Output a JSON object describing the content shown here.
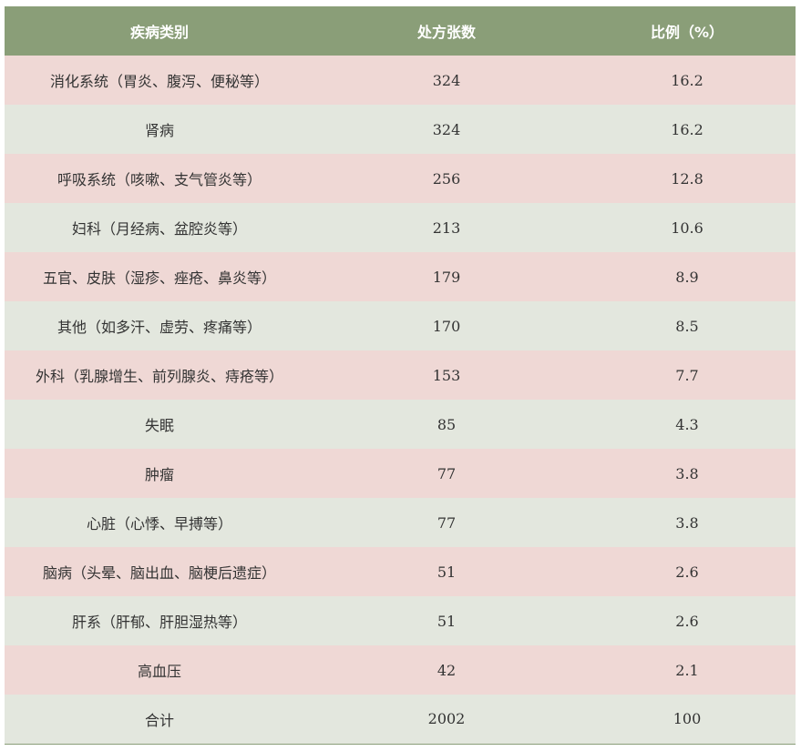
{
  "table": {
    "headers": [
      "疾病类别",
      "处方张数",
      "比例（%）"
    ],
    "rows": [
      [
        "消化系统（胃炎、腹泻、便秘等）",
        "324",
        "16.2"
      ],
      [
        "肾病",
        "324",
        "16.2"
      ],
      [
        "呼吸系统（咳嗽、支气管炎等）",
        "256",
        "12.8"
      ],
      [
        "妇科（月经病、盆腔炎等）",
        "213",
        "10.6"
      ],
      [
        "五官、皮肤（湿疹、痤疮、鼻炎等）",
        "179",
        "8.9"
      ],
      [
        "其他（如多汗、虚劳、疼痛等）",
        "170",
        "8.5"
      ],
      [
        "外科（乳腺增生、前列腺炎、痔疮等）",
        "153",
        "7.7"
      ],
      [
        "失眠",
        "85",
        "4.3"
      ],
      [
        "肿瘤",
        "77",
        "3.8"
      ],
      [
        "心脏（心悸、早搏等）",
        "77",
        "3.8"
      ],
      [
        "脑病（头晕、脑出血、脑梗后遗症）",
        "51",
        "2.6"
      ],
      [
        "肝系（肝郁、肝胆湿热等）",
        "51",
        "2.6"
      ],
      [
        "高血压",
        "42",
        "2.1"
      ],
      [
        "合计",
        "2002",
        "100"
      ]
    ]
  },
  "colors": {
    "header_bg": "#8a9e78",
    "row_odd_bg": "#efd8d5",
    "row_even_bg": "#e3e7de",
    "text": "#333333"
  }
}
